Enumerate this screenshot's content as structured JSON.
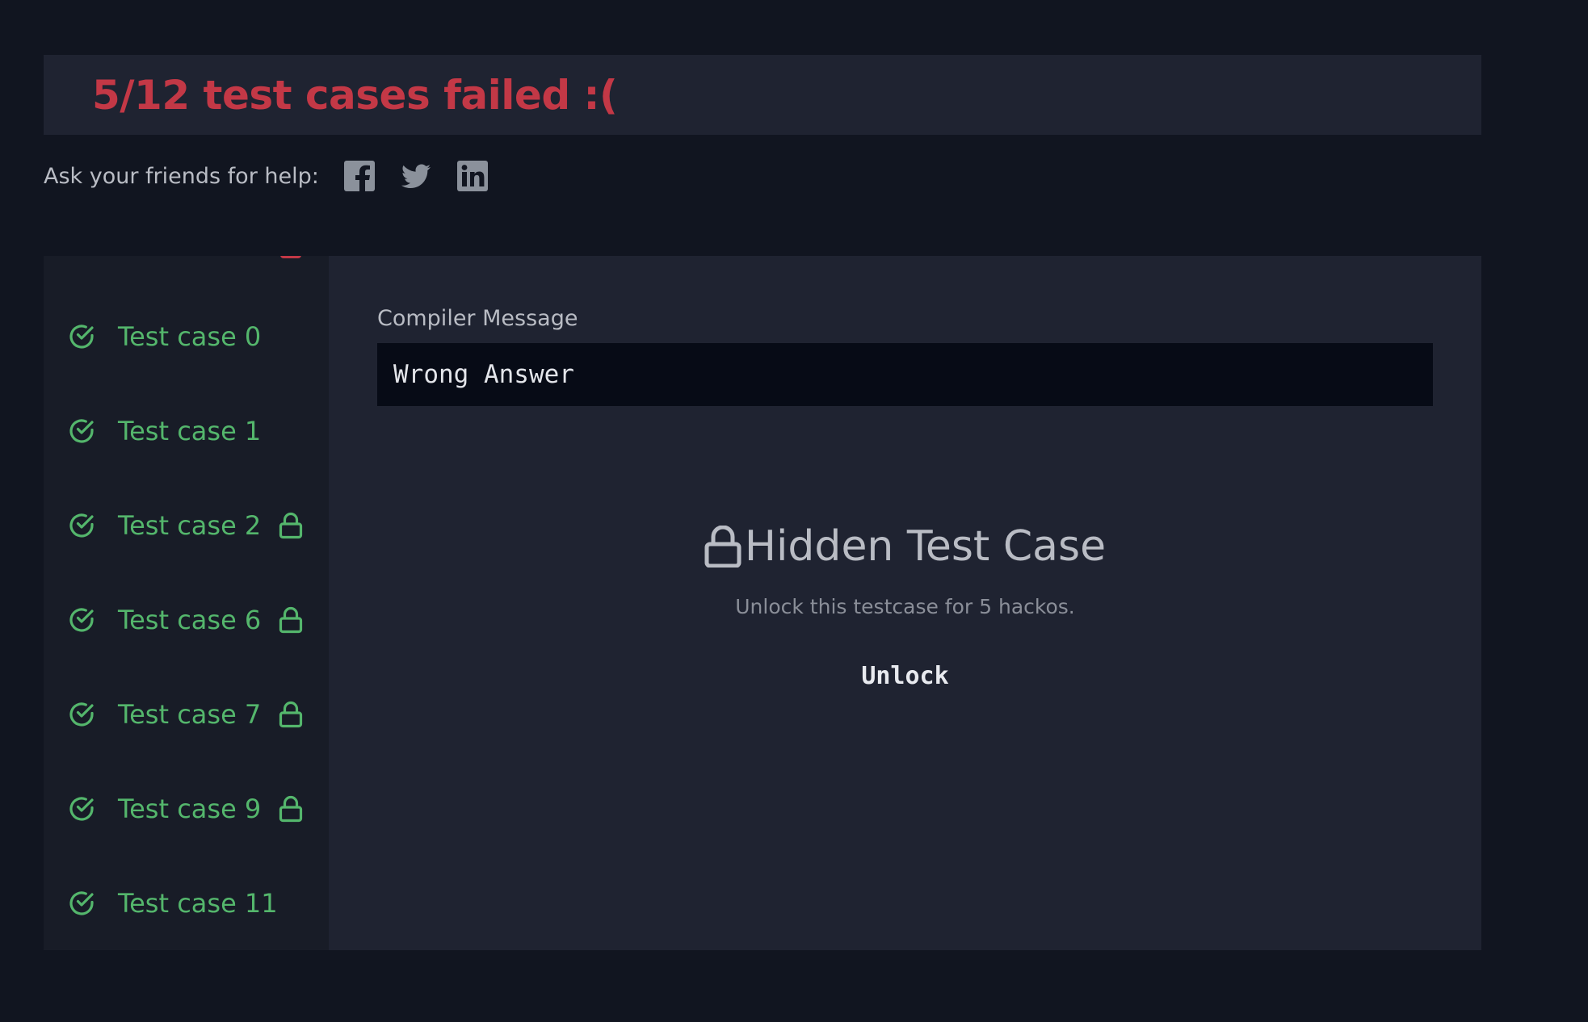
{
  "banner": {
    "title": "5/12 test cases failed :("
  },
  "share": {
    "label": "Ask your friends for help:",
    "icons": [
      "facebook-icon",
      "twitter-icon",
      "linkedin-icon"
    ]
  },
  "test_cases": [
    {
      "label": "Test case 0",
      "status": "passed",
      "locked": false
    },
    {
      "label": "Test case 1",
      "status": "passed",
      "locked": false
    },
    {
      "label": "Test case 2",
      "status": "passed",
      "locked": true
    },
    {
      "label": "Test case 6",
      "status": "passed",
      "locked": true
    },
    {
      "label": "Test case 7",
      "status": "passed",
      "locked": true
    },
    {
      "label": "Test case 9",
      "status": "passed",
      "locked": true
    },
    {
      "label": "Test case 11",
      "status": "passed",
      "locked": false
    }
  ],
  "compiler": {
    "label": "Compiler Message",
    "message": "Wrong Answer"
  },
  "hidden": {
    "title": "Hidden Test Case",
    "subtitle": "Unlock this testcase for 5 hackos.",
    "unlock_label": "Unlock"
  },
  "colors": {
    "fail_red": "#c33846",
    "pass_green": "#54b66c",
    "background": "#111520",
    "panel": "#1f2331",
    "sidebar": "#181c27",
    "code_box": "#070b16"
  }
}
